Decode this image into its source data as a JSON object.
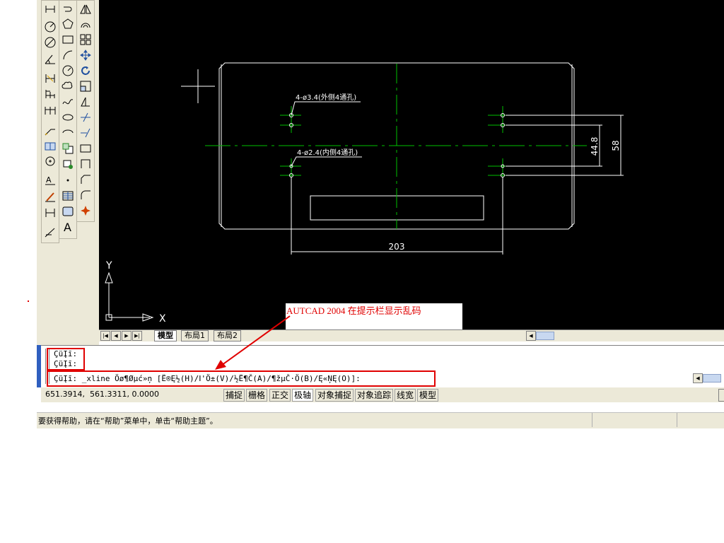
{
  "drawing": {
    "label_hole_outer": "4-ø3.4(外侧4通孔)",
    "label_hole_inner": "4-ø2.4(内侧4通孔)",
    "dim_203": "203",
    "dim_44_8": "44.8",
    "dim_58": "58",
    "ucs_x": "X",
    "ucs_y": "Y"
  },
  "tabs": {
    "model": "模型",
    "layout1": "布局1",
    "layout2": "布局2"
  },
  "annotation": {
    "text": "AUTCAD 2004 在提示栏显示乱码"
  },
  "command": {
    "line1": "ÇüĮī:",
    "line2": "ÇüĮī:",
    "line3": "ÇüĮī: _xline Öø¶Øµć»ņ [Ë®Ę½(H)/Ⅰ'Ö±(V)/½Ë¶Č(A)/¶žµČ·Ö(B)/Ę«ŅĘ(O)]:"
  },
  "status": {
    "coords": "651.3914,  561.3311, 0.0000",
    "buttons": [
      "捕捉",
      "栅格",
      "正交",
      "极轴",
      "对象捕捉",
      "对象追踪",
      "线宽",
      "模型"
    ]
  },
  "help": {
    "text": "要获得帮助，请在“帮助”菜单中，单击“帮助主题”。"
  },
  "colors": {
    "canvas": "#000000",
    "geometry": "#ffffff",
    "centerline": "#00c000",
    "annotation": "#e00000"
  }
}
